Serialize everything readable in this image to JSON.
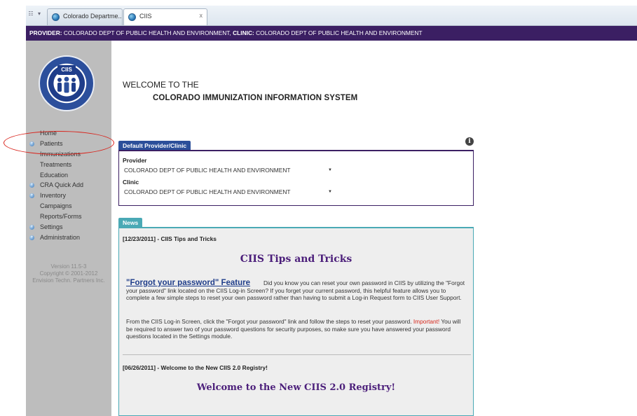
{
  "browser": {
    "tabs": [
      {
        "label": "Colorado Departme..."
      },
      {
        "label": "CIIS"
      }
    ],
    "close_glyph": "x"
  },
  "provider_bar": {
    "provider_key": "PROVIDER:",
    "provider_value": "COLORADO DEPT OF PUBLIC HEALTH AND ENVIRONMENT,",
    "clinic_key": "CLINIC:",
    "clinic_value": "COLORADO DEPT OF PUBLIC HEALTH AND ENVIRONMENT"
  },
  "logo": {
    "text": "CIIS",
    "icon": "ciis-logo-seal"
  },
  "sidebar": {
    "items": [
      {
        "label": "Home",
        "expandable": false
      },
      {
        "label": "Patients",
        "expandable": true
      },
      {
        "label": "Immunizations",
        "expandable": false
      },
      {
        "label": "Treatments",
        "expandable": false
      },
      {
        "label": "Education",
        "expandable": false
      },
      {
        "label": "CRA Quick Add",
        "expandable": true
      },
      {
        "label": "Inventory",
        "expandable": true
      },
      {
        "label": "Campaigns",
        "expandable": false
      },
      {
        "label": "Reports/Forms",
        "expandable": false
      },
      {
        "label": "Settings",
        "expandable": true
      },
      {
        "label": "Administration",
        "expandable": true
      }
    ],
    "version": "Version 11.5-3",
    "copyright": "Copyright © 2001-2012",
    "company": "Envision Techn. Partners Inc."
  },
  "welcome": {
    "line1": "WELCOME TO THE",
    "line2": "COLORADO IMMUNIZATION INFORMATION SYSTEM"
  },
  "info_icon": "i",
  "default_panel": {
    "tab_label": "Default Provider/Clinic",
    "provider_label": "Provider",
    "provider_value": "COLORADO DEPT OF PUBLIC HEALTH AND ENVIRONMENT",
    "clinic_label": "Clinic",
    "clinic_value": "COLORADO DEPT OF PUBLIC HEALTH AND ENVIRONMENT"
  },
  "news": {
    "tab_label": "News",
    "item1": {
      "date_line": "[12/23/2011] - CIIS Tips and Tricks",
      "title": "CIIS Tips and Tricks",
      "heading": "\"Forgot your password\" Feature",
      "para1": "Did you know you can reset your own password in CIIS by utilizing the \"Forgot your password\" link located on the CIIS Log-in Screen? If you forget your current password, this helpful feature allows you to complete a few simple steps to reset your own password rather than having to submit a Log-in Request form to CIIS User Support.",
      "para2": "From the CIIS Log-in Screen, click the \"Forgot your password\" link and follow the steps to reset your password.",
      "important_label": "Important!",
      "para3": "You will be required to answer two of your password questions for security purposes, so make sure you have answered your password questions located in the Settings module."
    },
    "item2": {
      "date_line": "[06/26/2011] - Welcome to the New CIIS 2.0 Registry!",
      "title": "Welcome to the New CIIS 2.0 Registry!"
    }
  },
  "colors": {
    "provider_bar": "#3b1f63",
    "sidebar": "#bdbdbd",
    "panel_tab": "#2b4f9a",
    "news_accent": "#4aa9b5",
    "news_title": "#4b1e7a",
    "annotation_oval": "#d9241c"
  }
}
